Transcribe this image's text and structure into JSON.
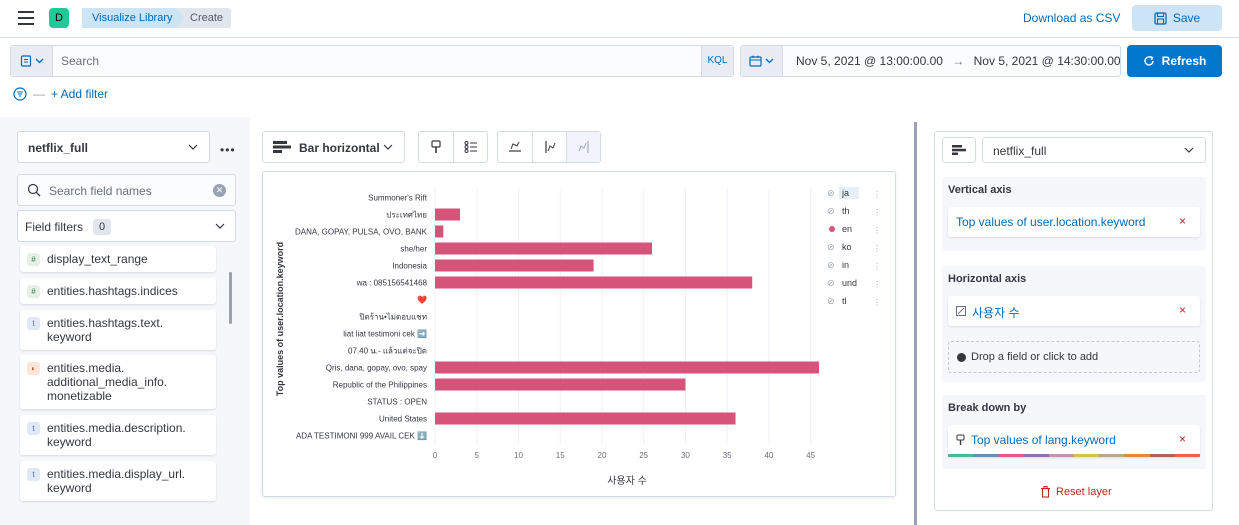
{
  "header": {
    "avatar_letter": "D",
    "breadcrumbs": [
      "Visualize Library",
      "Create"
    ],
    "download_csv": "Download as CSV",
    "save": "Save"
  },
  "query": {
    "search_placeholder": "Search",
    "language": "KQL",
    "date_start": "Nov 5, 2021 @ 13:00:00.00",
    "date_arrow": "→",
    "date_end": "Nov 5, 2021 @ 14:30:00.00",
    "refresh": "Refresh",
    "add_filter": "+ Add filter"
  },
  "sidebar": {
    "data_view": "netflix_full",
    "more": "•••",
    "field_search_placeholder": "Search field names",
    "field_filters": "Field filters",
    "field_filters_count": "0",
    "fields": [
      {
        "type": "#",
        "kind": "num",
        "name": "display_text_range"
      },
      {
        "type": "#",
        "kind": "num",
        "name": "entities.hashtags.indices"
      },
      {
        "type": "t",
        "kind": "str",
        "name": "entities.hashtags.text.\nkeyword"
      },
      {
        "type": "◐",
        "kind": "geo",
        "name": "entities.media.\nadditional_media_info.\nmonetizable"
      },
      {
        "type": "t",
        "kind": "str",
        "name": "entities.media.description.\nkeyword"
      },
      {
        "type": "t",
        "kind": "str",
        "name": "entities.media.display_url.\nkeyword"
      }
    ]
  },
  "workspace": {
    "chart_type": "Bar horizontal"
  },
  "chart_data": {
    "type": "bar",
    "orientation": "horizontal",
    "categories": [
      "Summoner's Rift",
      "ประเทศไทย",
      "DANA, GOPAY, PULSA, OVO, BANK",
      "she/her",
      "Indonesia",
      "wa : 085156541468",
      "❤️",
      "ปิดร้าน•ไม่ตอบแชท",
      "liat liat testimoni cek ➡️",
      "07.40 น.- แล้วแต่จะปิด",
      "Qris, dana, gopay, ovo, spay",
      "Republic of the Philippines",
      "STATUS : OPEN",
      "United States",
      "ADA TESTIMONI 999 AVAIL CEK ⬇️"
    ],
    "values": [
      0,
      3,
      1,
      26,
      19,
      38,
      0,
      0,
      0,
      0,
      46,
      30,
      0,
      36,
      0
    ],
    "xlabel": "사용자 수",
    "ylabel": "Top values of user.location.keyword",
    "xticks": [
      0,
      5,
      10,
      15,
      20,
      25,
      30,
      35,
      40,
      45
    ],
    "xlim": [
      0,
      46
    ],
    "legend": [
      "ja",
      "th",
      "en",
      "ko",
      "in",
      "und",
      "tl"
    ],
    "legend_active": "en",
    "bar_color": "#d6537a"
  },
  "config": {
    "data_view": "netflix_full",
    "vertical_axis_label": "Vertical axis",
    "vertical_axis_value": "Top values of user.location.keyword",
    "horizontal_axis_label": "Horizontal axis",
    "horizontal_axis_value": "사용자 수",
    "drop_hint": "Drop a field or click to add",
    "breakdown_label": "Break down by",
    "breakdown_value": "Top values of lang.keyword",
    "remove": "×",
    "reset_layer": "Reset layer"
  }
}
